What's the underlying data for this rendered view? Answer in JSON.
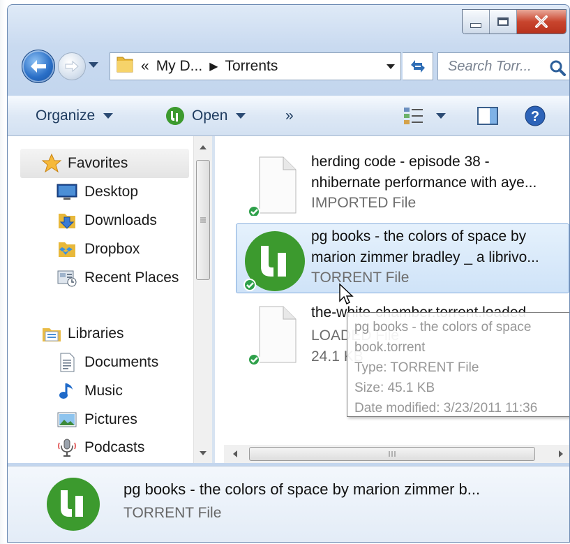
{
  "window": {
    "minimize_icon": "minimize-icon",
    "maximize_icon": "maximize-icon",
    "close_icon": "close-icon"
  },
  "nav": {
    "back_icon": "back-arrow-icon",
    "forward_icon": "forward-arrow-icon",
    "address": {
      "overflow": "«",
      "segments": [
        "My D...",
        "Torrents"
      ]
    },
    "search_placeholder": "Search Torr..."
  },
  "toolbar": {
    "organize": "Organize",
    "open": "Open",
    "more": "»"
  },
  "sidebar": {
    "favorites_label": "Favorites",
    "favorites": [
      {
        "label": "Desktop",
        "icon": "desktop-icon"
      },
      {
        "label": "Downloads",
        "icon": "downloads-folder-icon"
      },
      {
        "label": "Dropbox",
        "icon": "dropbox-folder-icon"
      },
      {
        "label": "Recent Places",
        "icon": "recent-places-icon"
      }
    ],
    "libraries_label": "Libraries",
    "libraries": [
      {
        "label": "Documents",
        "icon": "documents-icon"
      },
      {
        "label": "Music",
        "icon": "music-icon"
      },
      {
        "label": "Pictures",
        "icon": "pictures-icon"
      },
      {
        "label": "Podcasts",
        "icon": "podcasts-icon"
      }
    ]
  },
  "files": [
    {
      "line1": "herding code - episode 38 -",
      "line2": "nhibernate performance with aye...",
      "type": "IMPORTED File",
      "icon": "blank-file-icon",
      "selected": false
    },
    {
      "line1": "pg books - the colors of space  by",
      "line2": "marion zimmer bradley _ a librivo...",
      "type": "TORRENT File",
      "icon": "utorrent-icon",
      "selected": true
    },
    {
      "line1": "the-white-chamber.torrent.loaded",
      "line2": "LOADED File",
      "type": "24.1 KB",
      "icon": "blank-file-icon",
      "selected": false
    }
  ],
  "tooltip": {
    "line1": "pg books - the colors of space",
    "line2": "book.torrent",
    "type": "Type: TORRENT File",
    "size": "Size: 45.1 KB",
    "date": "Date modified: 3/23/2011 11:36"
  },
  "details": {
    "name": "pg books - the colors of space  by marion zimmer b...",
    "type": "TORRENT File"
  },
  "colors": {
    "accent": "#2a6fc7",
    "selection": "#cfe3f8",
    "utorrent": "#3c9a2e"
  }
}
